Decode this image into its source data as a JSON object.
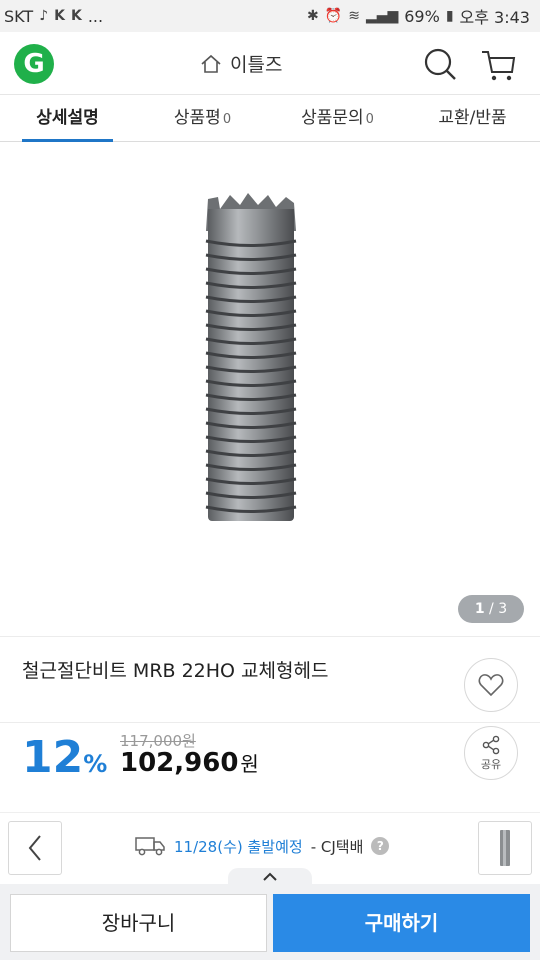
{
  "status_bar": {
    "carrier": "SKT",
    "more": "...",
    "battery": "69%",
    "time": "오후 3:43"
  },
  "header": {
    "logo_letter": "G",
    "home_label": "이틀즈"
  },
  "tabs": [
    {
      "label": "상세설명",
      "count": ""
    },
    {
      "label": "상품평",
      "count": "0"
    },
    {
      "label": "상품문의",
      "count": "0"
    },
    {
      "label": "교환/반품",
      "count": ""
    }
  ],
  "gallery": {
    "current": "1",
    "separator": "/",
    "total": "3"
  },
  "product": {
    "title": "철근절단비트 MRB 22HO 교체형헤드",
    "discount": "12",
    "discount_unit": "%",
    "original_price": "117,000원",
    "price": "102,960",
    "price_unit": "원",
    "share_label": "공유"
  },
  "shipping": {
    "date_text": "11/28(수) 출발예정",
    "carrier_text": "- CJ택배",
    "help": "?"
  },
  "actions": {
    "cart_label": "장바구니",
    "buy_label": "구매하기"
  },
  "colors": {
    "accent": "#2a8ae6",
    "discount": "#1f7fd6",
    "logo": "#20b04a"
  }
}
